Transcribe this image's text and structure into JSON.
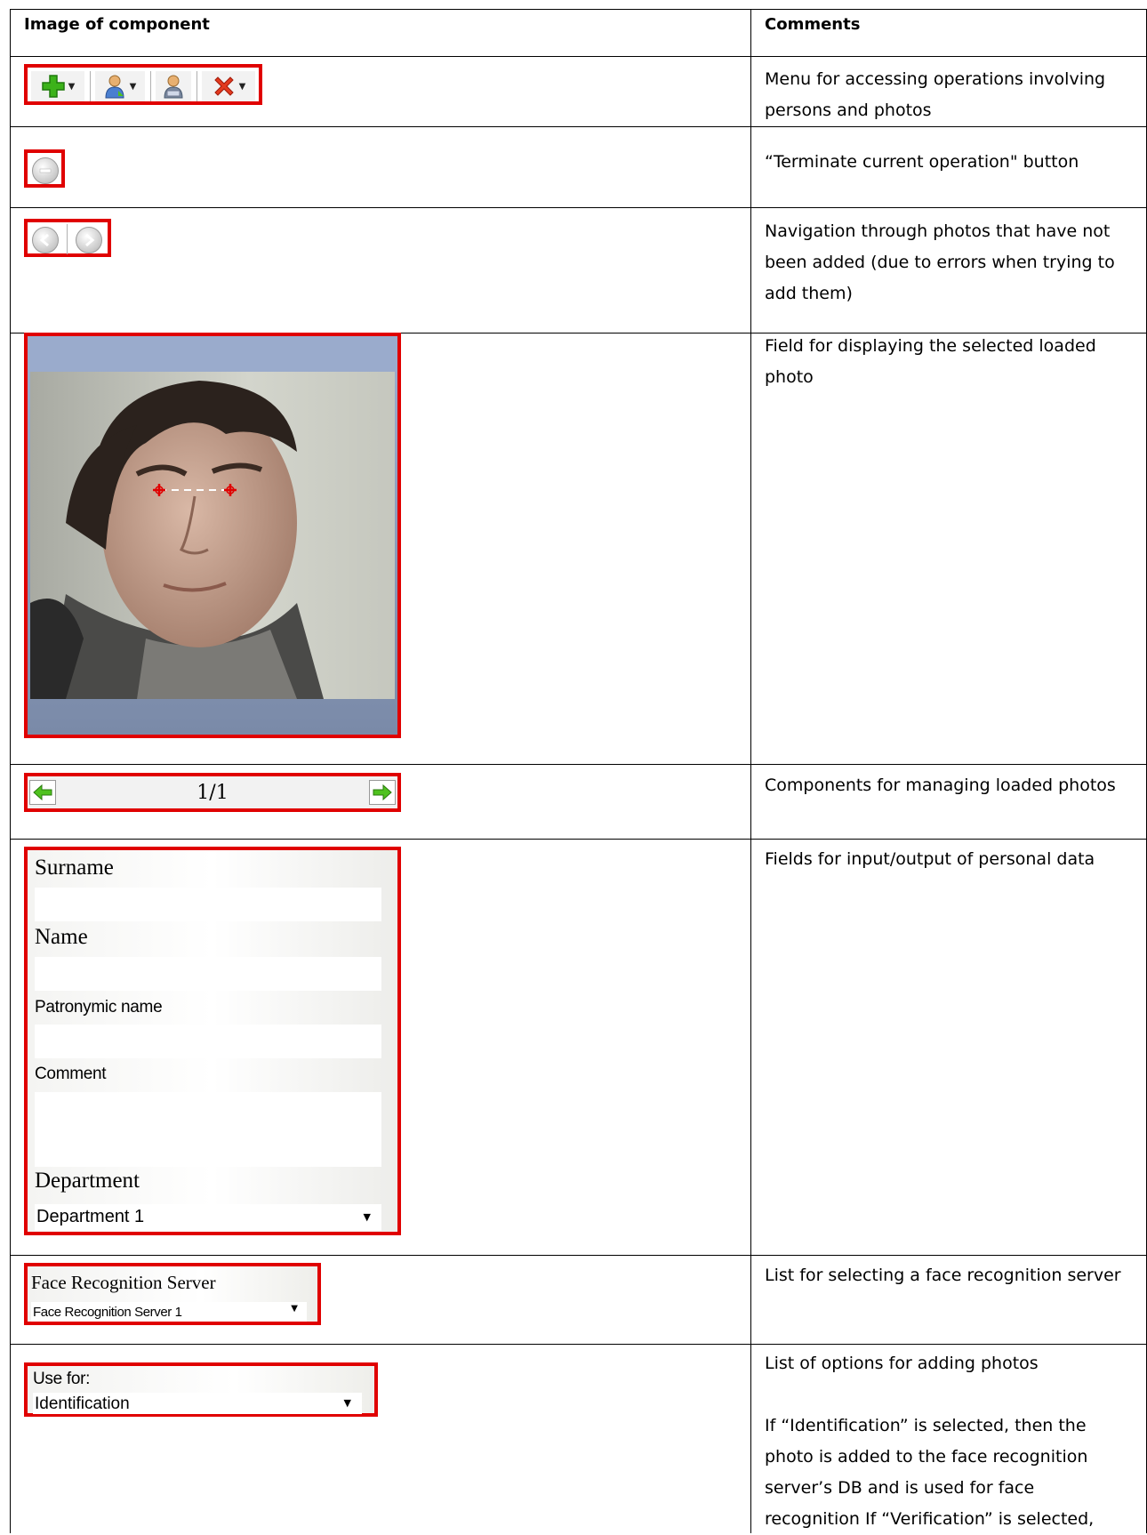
{
  "table": {
    "col1_header": "Image of component",
    "col2_header": "Comments"
  },
  "rows": {
    "toolbar": {
      "comment": "Menu for accessing operations involving persons and photos",
      "icons": [
        "add-icon",
        "person-icon",
        "person-search-icon",
        "delete-icon"
      ]
    },
    "terminate": {
      "comment": "“Terminate current operation\" button",
      "icon": "minus-circle-icon"
    },
    "navigation": {
      "comment": "Navigation through photos that have not been added (due to errors when trying to add them)",
      "icons": [
        "arrow-left-circle-icon",
        "arrow-right-circle-icon"
      ]
    },
    "photo": {
      "comment": "Field for displaying the selected loaded photo",
      "image": "face-photo"
    },
    "photo_nav": {
      "comment": "Components for managing loaded photos",
      "counter": "1/1"
    },
    "personal_data": {
      "comment": "Fields for input/output of personal data",
      "surname_label": "Surname",
      "name_label": "Name",
      "patronymic_label": "Patronymic name",
      "comment_label": "Comment",
      "department_label": "Department",
      "department_value": "Department 1"
    },
    "server": {
      "comment": "List for selecting a face recognition server",
      "label": "Face Recognition Server",
      "value": "Face Recognition Server 1"
    },
    "use_for": {
      "comment_title": "List of options for adding photos",
      "comment_body": "If “Identification” is selected, then the photo is added to the face recognition server’s DB and is used for face recognition If “Verification” is selected,",
      "label": "Use for:",
      "value": "Identification"
    }
  },
  "colors": {
    "highlight": "#e00000",
    "add_icon": "#3cb21a",
    "delete_icon": "#e33a1e",
    "nav_arrow": "#4fc21e"
  }
}
